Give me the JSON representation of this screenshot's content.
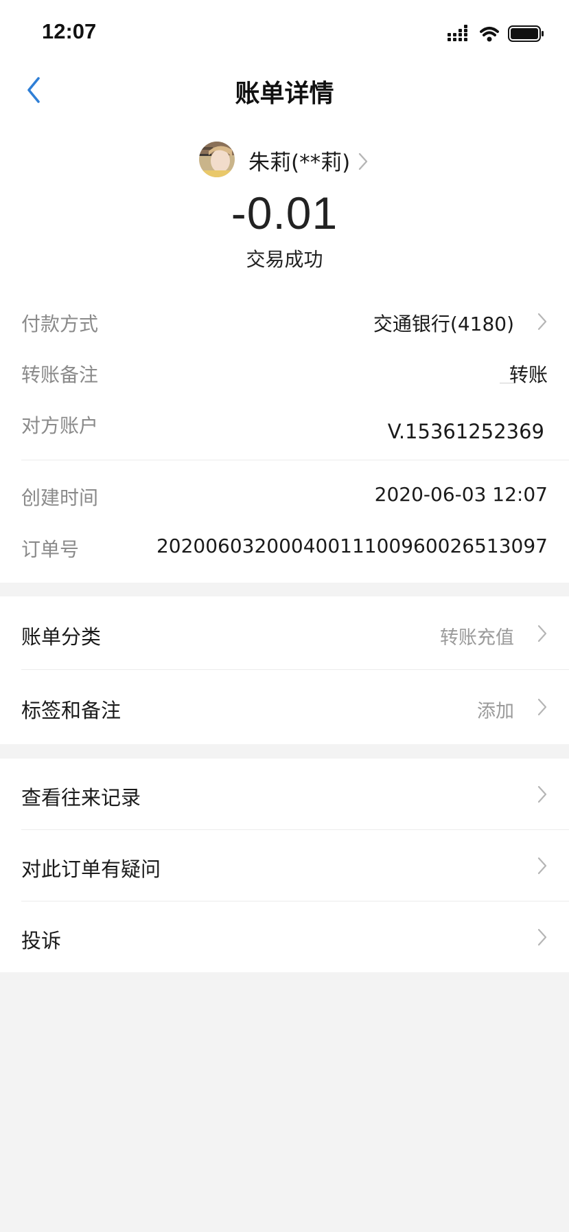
{
  "status_bar": {
    "time": "12:07",
    "icons": [
      "signal-icon",
      "wifi-icon",
      "battery-icon"
    ]
  },
  "nav": {
    "title": "账单详情",
    "back_icon": "chevron-left-icon"
  },
  "counterparty": {
    "name": "朱莉(**莉)"
  },
  "transaction": {
    "amount": "-0.01",
    "status": "交易成功"
  },
  "details": {
    "payment_method_label": "付款方式",
    "payment_method_value": "交通银行(4180)",
    "remark_label": "转账备注",
    "remark_value": "转账",
    "account_label": "对方账户",
    "account_value": "V.15361252369",
    "created_label": "创建时间",
    "created_value": "2020-06-03 12:07",
    "order_label": "订单号",
    "order_value": "20200603200040011100960026513097"
  },
  "category_section": {
    "category_label": "账单分类",
    "category_value": "转账充值",
    "tags_label": "标签和备注",
    "tags_value": "添加"
  },
  "actions": {
    "history_label": "查看往来记录",
    "question_label": "对此订单有疑问",
    "complaint_label": "投诉"
  },
  "colors": {
    "accent": "#2f7fd6",
    "background": "#f3f3f3",
    "card": "#ffffff",
    "label_gray": "#8a8a8a"
  }
}
